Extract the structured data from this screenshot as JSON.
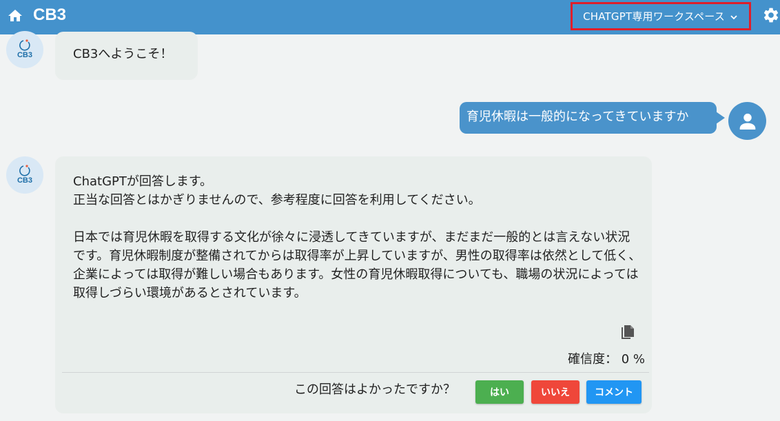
{
  "header": {
    "title": "CB3",
    "workspace": "CHATGPT専用ワークスペース"
  },
  "bot": {
    "logo_text": "CB3"
  },
  "messages": {
    "greeting": "CB3へようこそ！",
    "user_question": "育児休暇は一般的になってきていますか",
    "answer": "ChatGPTが回答します。\n正当な回答とはかぎりませんので、参考程度に回答を利用してください。\n\n日本では育児休暇を取得する文化が徐々に浸透してきていますが、まだまだ一般的とは言えない状況です。育児休暇制度が整備されてからは取得率が上昇していますが、男性の取得率は依然として低く、企業によっては取得が難しい場合もあります。女性の育児休暇取得についても、職場の状況によっては取得しづらい環境があるとされています。"
  },
  "answer_footer": {
    "confidence": "確信度： 0 %",
    "feedback_question": "この回答はよかったですか？",
    "yes_label": "はい",
    "no_label": "いいえ",
    "comment_label": "コメント"
  },
  "colors": {
    "header": "#4492cc",
    "highlight": "#e01e2a",
    "yes": "#4caf50",
    "no": "#ef473a",
    "comment": "#2196f3"
  },
  "icons": {
    "home": "home-icon",
    "settings": "gear-icon",
    "dropdown": "chevron-down-icon",
    "copy": "copy-icon",
    "user": "user-icon"
  }
}
